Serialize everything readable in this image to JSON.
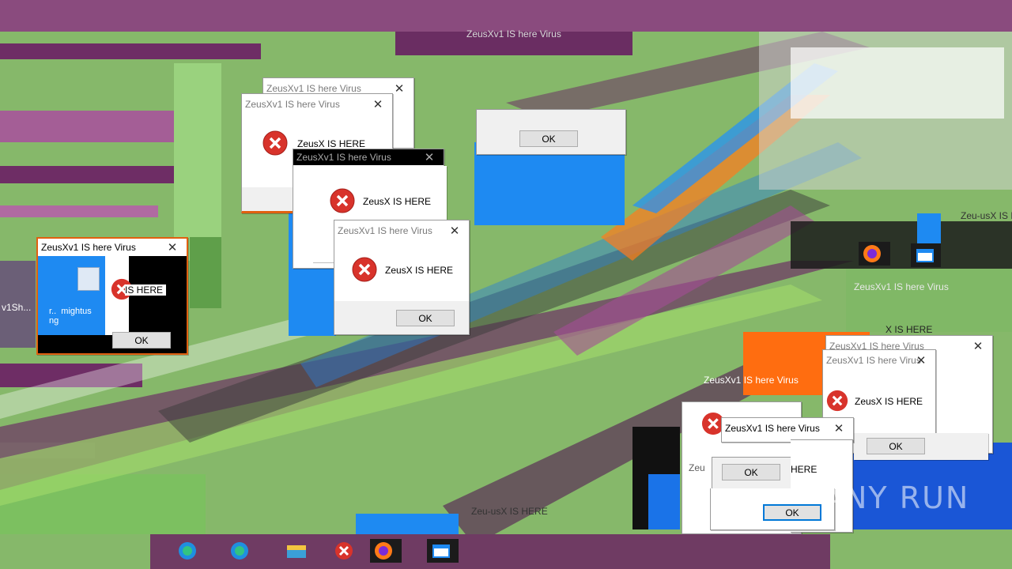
{
  "dialogs": {
    "title": "ZeusXv1 IS here Virus",
    "message": "ZeusX IS HERE",
    "ok": "OK"
  },
  "left_dialog": {
    "title": "ZeusXv1 IS here Virus",
    "message": "IS HERE",
    "icon_label": "r..  mightus\nng",
    "ok": "OK"
  },
  "floating_ok": "OK",
  "fragments": {
    "frag1": "Zeu-usX IS HERE",
    "frag2": "ZeusXv1 IS here Virus",
    "frag3": "X IS HERE",
    "frag4": "HERE",
    "frag5": "Zeu",
    "frag6": "ZeusXv1 IS here Virus",
    "frag7": "v1Sh...",
    "frag8": "Zeu-usX IS HERE",
    "frag9": "ZeusXv1 IS here Virus"
  },
  "taskbar": {
    "icons": [
      "edge-icon",
      "edge-icon",
      "file-explorer-icon",
      "error-icon",
      "firefox-icon",
      "window-icon"
    ]
  },
  "watermark": "ANY RUN",
  "colors": {
    "accent": "#0078d7",
    "error": "#d32f2f",
    "purple": "#7a2a6e",
    "green": "#86b86a",
    "orange": "#f56a00"
  }
}
